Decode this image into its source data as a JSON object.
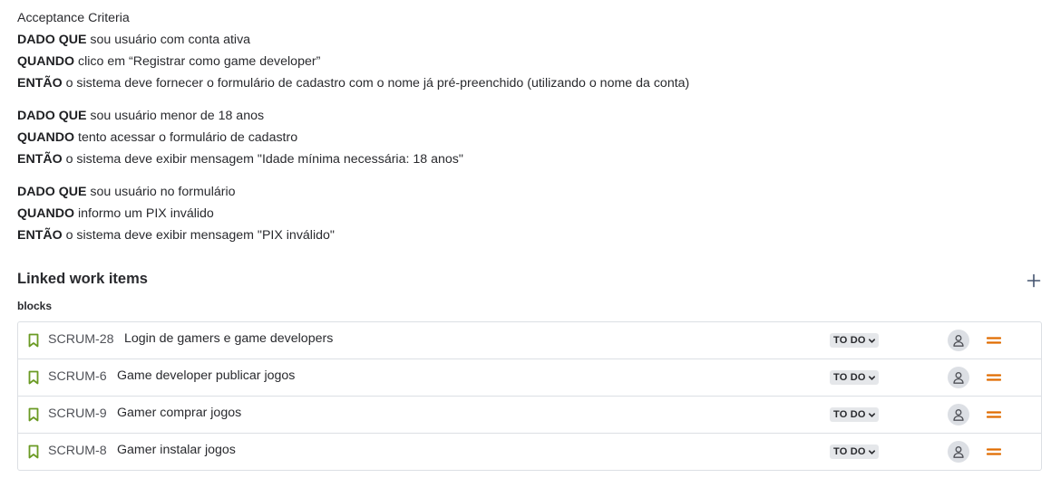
{
  "criteria": {
    "heading": "Acceptance Criteria",
    "scenarios": [
      {
        "given_kw": "DADO QUE",
        "given": " sou usuário com conta ativa",
        "when_kw": "QUANDO",
        "when": " clico em “Registrar como game developer”",
        "then_kw": "ENTÃO",
        "then": " o sistema deve fornecer o formulário de cadastro com o nome já pré-preenchido (utilizando o nome da conta)"
      },
      {
        "given_kw": "DADO QUE",
        "given": " sou usuário menor de 18 anos",
        "when_kw": "QUANDO",
        "when": " tento acessar o formulário de cadastro",
        "then_kw": "ENTÃO",
        "then": " o sistema deve exibir mensagem \"Idade mínima necessária: 18 anos\""
      },
      {
        "given_kw": "DADO QUE",
        "given": " sou usuário no formulário",
        "when_kw": "QUANDO",
        "when": " informo um PIX inválido",
        "then_kw": "ENTÃO",
        "then": " o sistema deve exibir mensagem \"PIX inválido\""
      }
    ]
  },
  "linked": {
    "title": "Linked work items",
    "add_icon": "plus-icon",
    "relation": "blocks",
    "items": [
      {
        "key": "SCRUM-28",
        "summary": "Login de gamers e game developers",
        "status": "TO DO",
        "priority": "medium"
      },
      {
        "key": "SCRUM-6",
        "summary": "Game developer publicar jogos",
        "status": "TO DO",
        "priority": "medium"
      },
      {
        "key": "SCRUM-9",
        "summary": "Gamer comprar jogos",
        "status": "TO DO",
        "priority": "medium"
      },
      {
        "key": "SCRUM-8",
        "summary": "Gamer instalar jogos",
        "status": "TO DO",
        "priority": "medium"
      }
    ]
  },
  "colors": {
    "story_icon": "#6a9a23",
    "priority_medium": "#e06c00",
    "status_bg": "#e5e7ea",
    "border": "#dcdfe4"
  }
}
